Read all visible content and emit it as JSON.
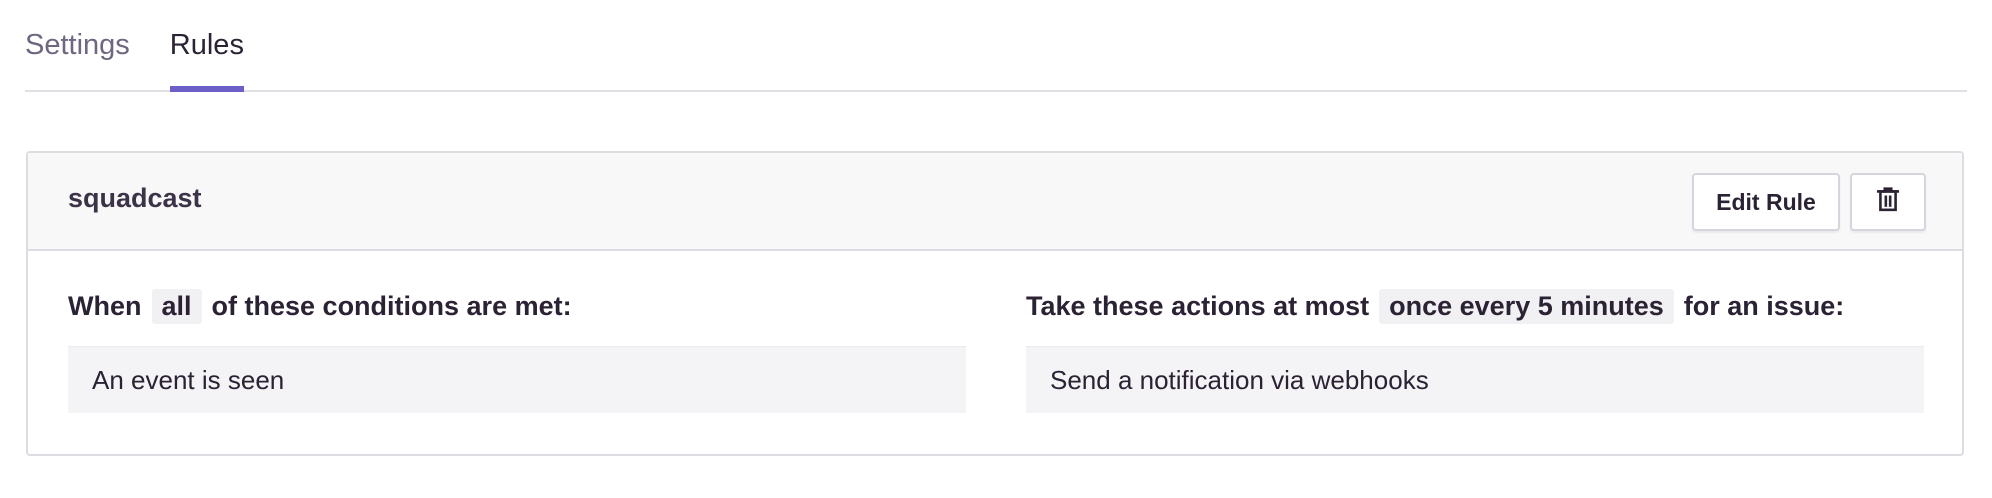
{
  "tabs": [
    {
      "label": "Settings",
      "active": false
    },
    {
      "label": "Rules",
      "active": true
    }
  ],
  "colors": {
    "accent": "#6c5fc7",
    "text": "#2b2233",
    "muted": "#6f6781"
  },
  "rule": {
    "name": "squadcast",
    "edit_label": "Edit Rule",
    "delete_icon": "trash-icon",
    "conditions": {
      "prefix": "When",
      "match": "all",
      "suffix": "of these conditions are met:",
      "items": [
        "An event is seen"
      ]
    },
    "actions": {
      "prefix": "Take these actions at most",
      "frequency": "once every 5 minutes",
      "suffix": "for an issue:",
      "items": [
        "Send a notification via webhooks"
      ]
    }
  }
}
